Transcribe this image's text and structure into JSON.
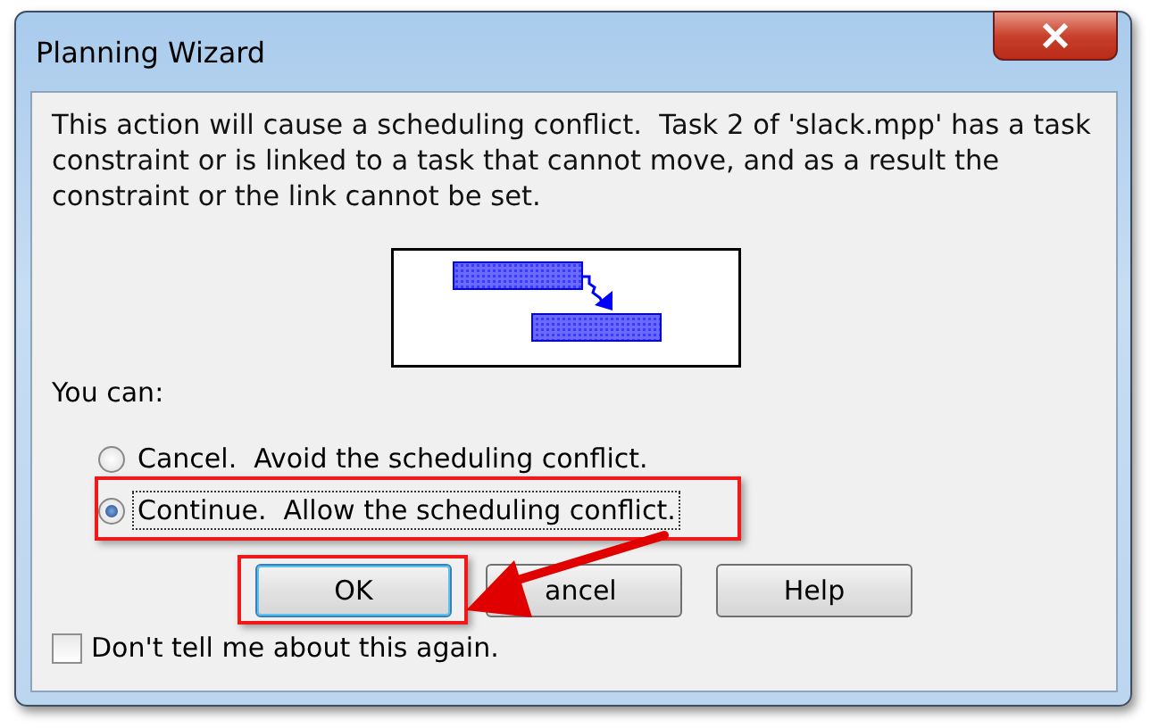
{
  "window": {
    "title": "Planning Wizard"
  },
  "message": "This action will cause a scheduling conflict.  Task 2 of 'slack.mpp' has a task constraint or is linked to a task that cannot move, and as a result the constraint or the link cannot be set.",
  "prompt": "You can:",
  "options": [
    {
      "label": "Cancel.  Avoid the scheduling conflict.",
      "selected": false,
      "focused": false
    },
    {
      "label": "Continue.  Allow the scheduling conflict.",
      "selected": true,
      "focused": true
    }
  ],
  "buttons": [
    {
      "label": "OK",
      "default": true
    },
    {
      "label": "ancel",
      "default": false
    },
    {
      "label": "Help",
      "default": false
    }
  ],
  "dont_tell_again": {
    "label": "Don't tell me about this again.",
    "checked": false
  },
  "annotations": [
    {
      "kind": "highlight-option"
    },
    {
      "kind": "highlight-button"
    },
    {
      "kind": "arrow"
    }
  ]
}
